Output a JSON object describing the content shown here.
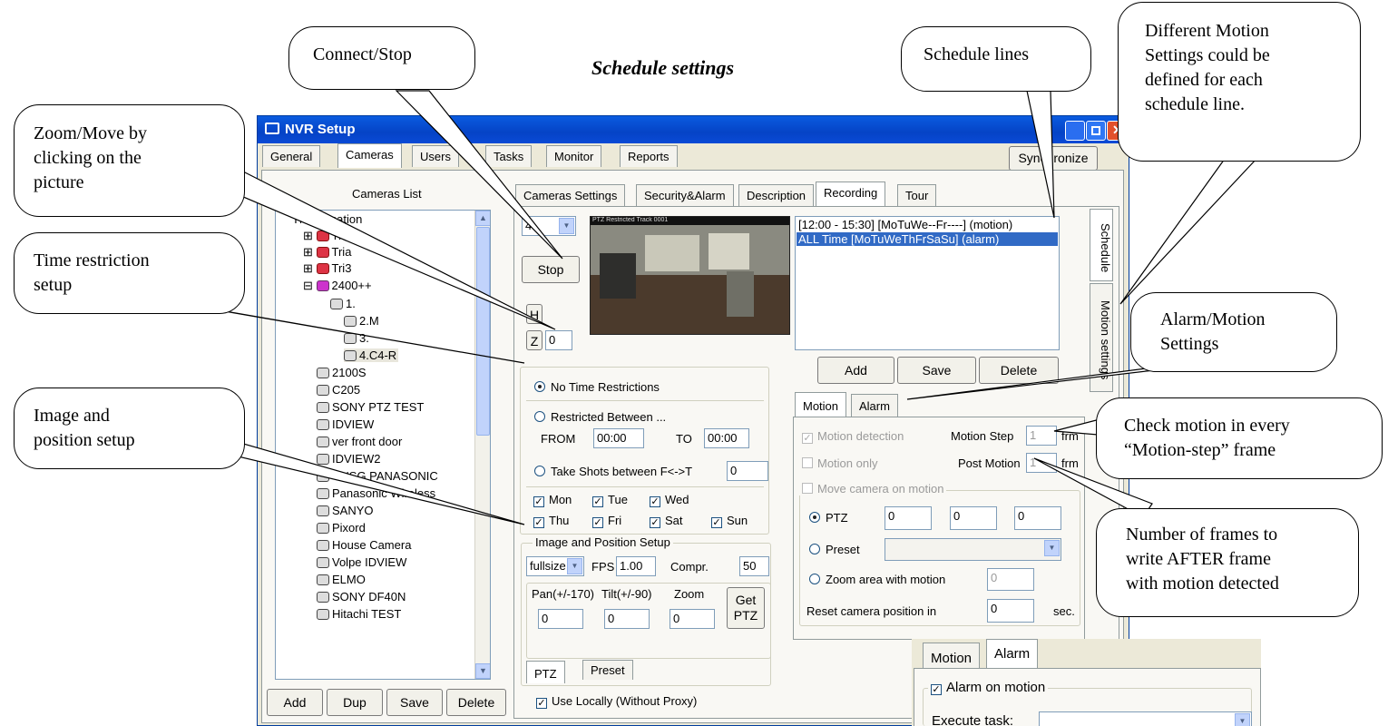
{
  "page_title": "Schedule settings",
  "callouts": {
    "connect_stop": [
      "Connect/Stop"
    ],
    "schedule_lines": [
      "Schedule lines"
    ],
    "motion_settings_per_line": [
      "Different Motion",
      "Settings could be",
      "defined for each",
      "schedule line."
    ],
    "zoom_move": [
      "Zoom/Move by",
      "clicking on the",
      "picture"
    ],
    "time_restriction": [
      "Time restriction",
      "setup"
    ],
    "image_position": [
      "Image and",
      "position setup"
    ],
    "alarm_motion_settings": [
      "Alarm/Motion",
      "Settings"
    ],
    "check_motion": [
      "Check motion in every",
      "“Motion-step” frame"
    ],
    "post_frames": [
      "Number of frames to",
      "write AFTER frame",
      "with motion detected"
    ]
  },
  "window": {
    "title": "NVR Setup",
    "main_tabs": [
      "General",
      "Cameras",
      "Users",
      "Tasks",
      "Monitor",
      "Reports"
    ],
    "synchronize": "Synchronize",
    "cameras_list_title": "Cameras List",
    "tree": {
      "root": "This Location",
      "groups": [
        "Tri1",
        "Tria",
        "Tri3",
        "2400++"
      ],
      "sub": [
        "1.",
        "2.M",
        "3.",
        "4.C4-R"
      ],
      "cameras": [
        "2100S",
        "C205",
        "SONY PTZ TEST",
        "IDVIEW",
        "ver front door",
        "IDVIEW2",
        "CNSG PANASONIC",
        "Panasonic Wireless",
        "SANYO",
        "Pixord",
        "House Camera",
        "Volpe IDVIEW",
        "ELMO",
        "SONY DF40N",
        "Hitachi TEST"
      ]
    },
    "list_buttons": [
      "Add",
      "Dup",
      "Save",
      "Delete"
    ],
    "sub_tabs": [
      "Cameras Settings",
      "Security&Alarm",
      "Description",
      "Recording",
      "Tour"
    ],
    "channel": "4",
    "stop": "Stop",
    "h_label": "H",
    "z_label": "Z",
    "z_value": "0",
    "video_overlay": "PTZ Restricted Track 0001",
    "time": {
      "no_restrict": "No Time Restrictions",
      "restricted": "Restricted Between ...",
      "from_label": "FROM",
      "from_value": "00:00",
      "to_label": "TO",
      "to_value": "00:00",
      "shots": "Take Shots between F<->T",
      "shots_value": "0",
      "days": [
        "Mon",
        "Tue",
        "Wed",
        "Thu",
        "Fri",
        "Sat",
        "Sun"
      ]
    },
    "image": {
      "legend": "Image and Position Setup",
      "size": "fullsize",
      "fps_label": "FPS",
      "fps": "1.00",
      "compr_label": "Compr.",
      "compr": "50",
      "pan_label": "Pan(+/-170)",
      "tilt_label": "Tilt(+/-90)",
      "zoom_label": "Zoom",
      "pan": "0",
      "tilt": "0",
      "zoom": "0",
      "get_ptz": [
        "Get",
        "PTZ"
      ],
      "tab_ptz": "PTZ",
      "tab_preset": "Preset"
    },
    "use_locally": "Use Locally (Without Proxy)",
    "schedule": {
      "lines": [
        "[12:00 - 15:30] [MoTuWe--Fr----] (motion)",
        "ALL Time [MoTuWeThFrSaSu] (alarm)"
      ],
      "add": "Add",
      "save": "Save",
      "delete": "Delete"
    },
    "side_tabs": [
      "Schedule",
      "Motion settings"
    ],
    "motion_tabs": [
      "Motion",
      "Alarm"
    ],
    "motion": {
      "detection": "Motion detection",
      "step_label": "Motion Step",
      "step": "1",
      "frm": "frm",
      "only": "Motion only",
      "post_label": "Post Motion",
      "post": "1",
      "move": "Move camera on motion",
      "ptz": "PTZ",
      "ptz_vals": [
        "0",
        "0",
        "0"
      ],
      "preset": "Preset",
      "zoom_area": "Zoom area with motion",
      "zoom_area_val": "0",
      "reset_label": "Reset camera position in",
      "reset_val": "0",
      "sec": "sec."
    }
  },
  "inset": {
    "tabs": [
      "Motion",
      "Alarm"
    ],
    "alarm_on_motion": "Alarm on motion",
    "execute_task": "Execute task:"
  }
}
